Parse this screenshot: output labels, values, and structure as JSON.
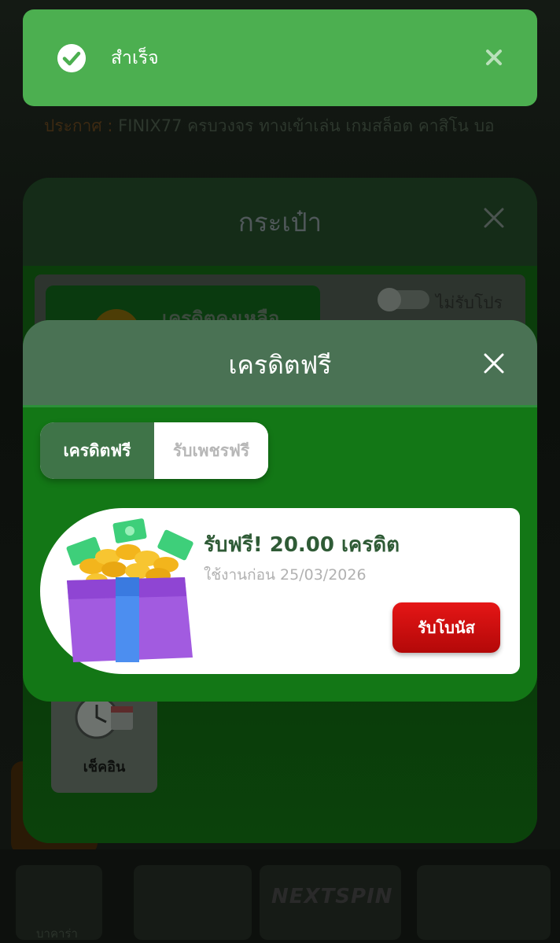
{
  "toast": {
    "message": "สำเร็จ",
    "icon": "check-circle-icon",
    "close_icon": "close-icon",
    "color": "#4caf50"
  },
  "background": {
    "marquee_prefix": "ประกาศ :",
    "marquee": "FINIX77 ครบวงจร ทางเข้าเล่น เกมสล็อต คาสิโน บอ",
    "game_label": "บาคาร่า",
    "provider_logo": "NEXTSPIN"
  },
  "wallet": {
    "title": "กระเป๋า",
    "balance_label": "เครดิตคงเหลือ",
    "no_promo_label": "ไม่รับโปร",
    "checkin_label": "เช็คอิน"
  },
  "modal": {
    "title": "เครดิตฟรี",
    "tabs": [
      {
        "label": "เครดิตฟรี",
        "active": true
      },
      {
        "label": "รับเพชรฟรี",
        "active": false
      }
    ],
    "bonus": {
      "title": "รับฟรี! 20.00 เครดิต",
      "expiry": "ใช้งานก่อน 25/03/2026",
      "claim_label": "รับโบนัส",
      "image": "gift-box-coins-icon"
    }
  },
  "colors": {
    "modal_green": "#137716",
    "header_green": "#4a7254",
    "claim_red": "#d10f0f",
    "title_green": "#2f5b36"
  }
}
